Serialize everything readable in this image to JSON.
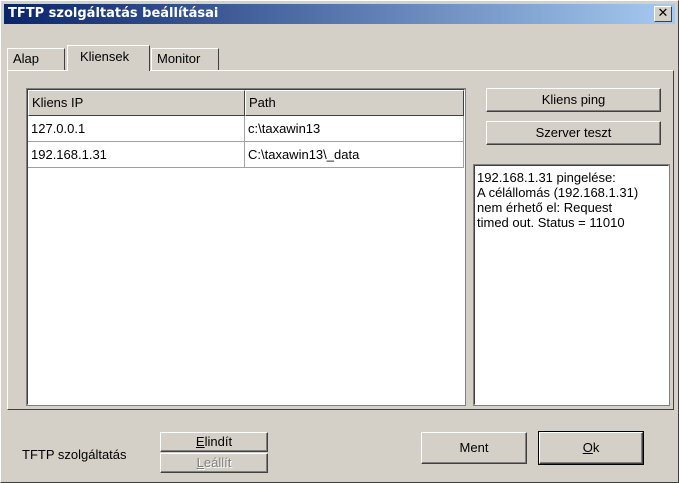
{
  "window": {
    "title": "TFTP szolgáltatás beállításai",
    "close_glyph": "✕"
  },
  "tabs": [
    {
      "label": "Alap"
    },
    {
      "label": "Kliensek"
    },
    {
      "label": "Monitor"
    }
  ],
  "grid": {
    "columns": [
      "Kliens IP",
      "Path"
    ],
    "rows": [
      {
        "ip": "127.0.0.1",
        "path": "c:\\taxawin13"
      },
      {
        "ip": "192.168.1.31",
        "path": "C:\\taxawin13\\_data"
      }
    ]
  },
  "actions": {
    "ping_label": "Kliens ping",
    "server_test_label": "Szerver teszt"
  },
  "output_text": "192.168.1.31 pingelése:\nA célállomás (192.168.1.31)\nnem érhető el: Request\ntimed out. Status = 11010",
  "footer": {
    "service_label": "TFTP szolgáltatás",
    "start": {
      "mnemonic": "E",
      "rest": "lindít"
    },
    "stop": {
      "mnemonic": "L",
      "rest": "eállít"
    },
    "save_label": "Ment",
    "ok": {
      "mnemonic": "O",
      "rest": "k"
    }
  }
}
